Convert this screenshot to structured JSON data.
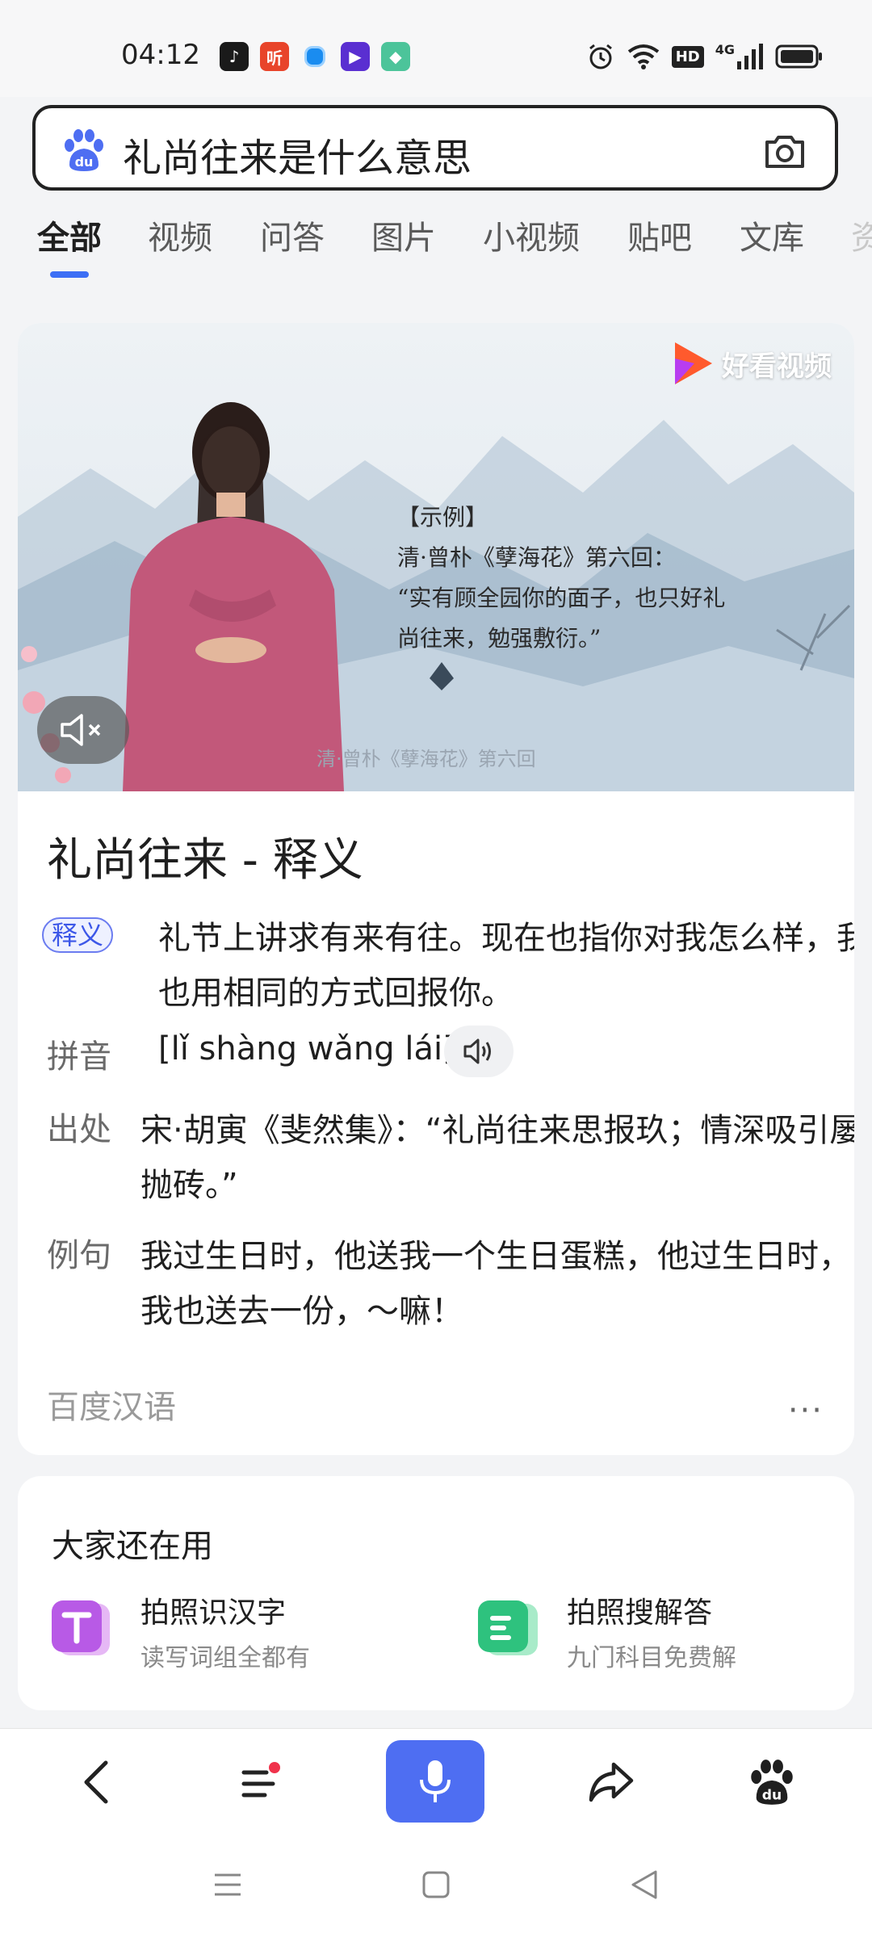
{
  "status_bar": {
    "time": "04:12",
    "apps": [
      {
        "name": "tiktok-icon",
        "color": "#1a1a1a",
        "glyph": "♪"
      },
      {
        "name": "ting-icon",
        "color": "#e8442a",
        "glyph": "听"
      },
      {
        "name": "dot-app-icon",
        "color": "#ffffff",
        "glyph": "●"
      },
      {
        "name": "video-app-icon",
        "color": "#5a2fd1",
        "glyph": "▶"
      },
      {
        "name": "green-app-icon",
        "color": "#4cc49a",
        "glyph": "◆"
      }
    ],
    "network_badge": "HD",
    "signal_label": "4G"
  },
  "search": {
    "query": "礼尚往来是什么意思"
  },
  "tabs": [
    "全部",
    "视频",
    "问答",
    "图片",
    "小视频",
    "贴吧",
    "文库",
    "资"
  ],
  "video": {
    "brand": "好看视频",
    "scroll_lines": [
      "【示例】",
      "清·曾朴《孽海花》第六回：",
      "“实有顾全园你的面子，也只好礼",
      "尚往来，勉强敷衍。”"
    ],
    "caption": "清·曾朴《孽海花》第六回"
  },
  "definition": {
    "title": "礼尚往来 - 释义",
    "badge": "释义",
    "meaning": "礼节上讲求有来有往。现在也指你对我怎么样，我也用相同的方式回报你。",
    "pinyin_label": "拼音",
    "pinyin": "[lǐ shàng wǎng lái]",
    "source_label": "出处",
    "source_text": "宋·胡寅《斐然集》：“礼尚往来思报玖；情深吸引屡抛砖。”",
    "example_label": "例句",
    "example_text": "我过生日时，他送我一个生日蛋糕，他过生日时，我也送去一份，～嘛！",
    "provider": "百度汉语",
    "more": "···"
  },
  "also_used": {
    "title": "大家还在用",
    "tools": [
      {
        "name": "拍照识汉字",
        "desc": "读写词组全都有",
        "color": "#b85ae6"
      },
      {
        "name": "拍照搜解答",
        "desc": "九门科目免费解",
        "color": "#2ec27e"
      }
    ]
  }
}
